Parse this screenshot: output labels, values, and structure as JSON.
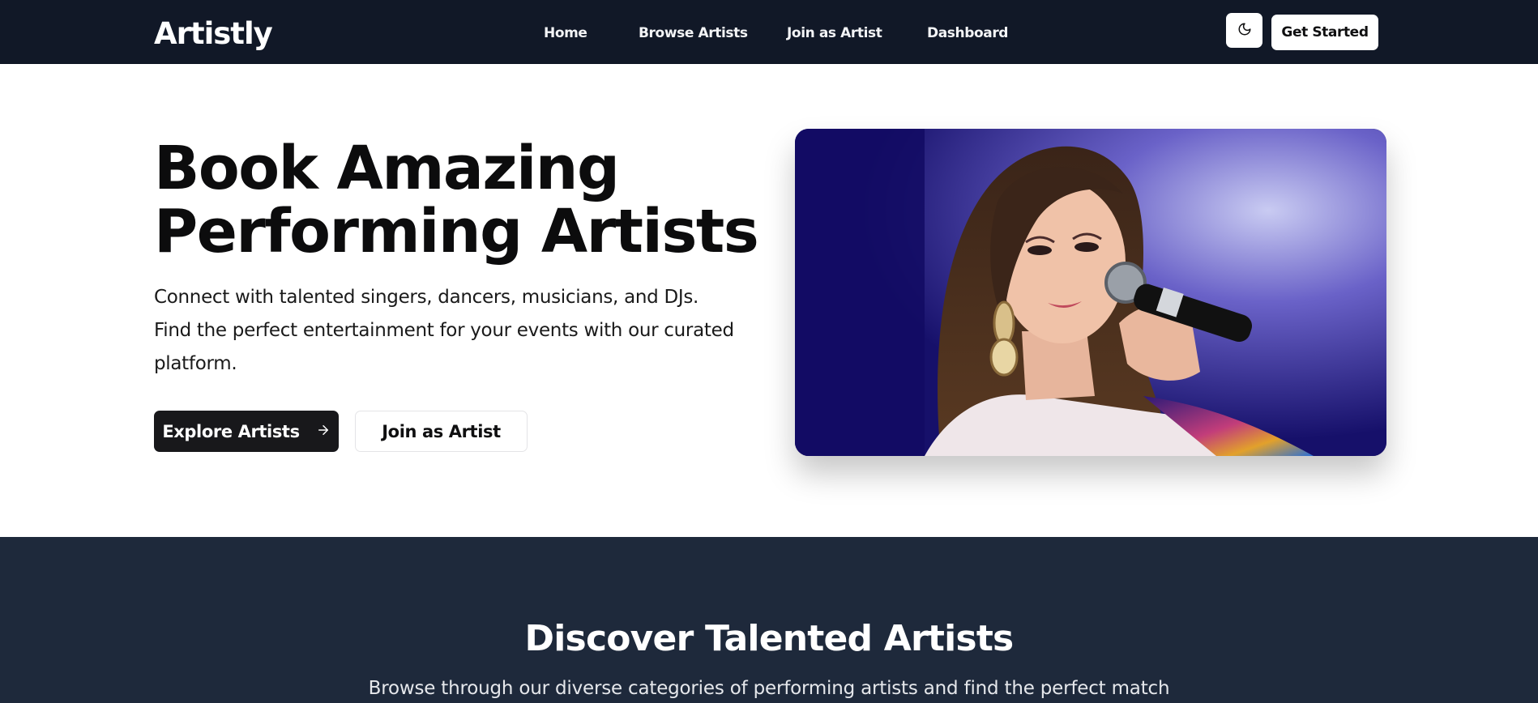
{
  "navbar": {
    "brand": "Artistly",
    "links": [
      {
        "label": "Home"
      },
      {
        "label": "Browse Artists"
      },
      {
        "label": "Join as Artist"
      },
      {
        "label": "Dashboard"
      }
    ],
    "theme_toggle_icon": "moon-icon",
    "get_started_label": "Get Started"
  },
  "hero": {
    "title_line1": "Book Amazing",
    "title_line2": "Performing Artists",
    "description": "Connect with talented singers, dancers, musicians, and DJs. Find the perfect entertainment for your events with our curated platform.",
    "primary_button_label": "Explore Artists",
    "primary_button_icon": "arrow-right-icon",
    "secondary_button_label": "Join as Artist",
    "image_subject": "performer-singing-photo"
  },
  "discover": {
    "title": "Discover Talented Artists",
    "subtitle": "Browse through our diverse categories of performing artists and find the perfect match"
  },
  "colors": {
    "navbar_bg": "#111827",
    "discover_bg": "#1e293b",
    "primary_button_bg": "#18181b",
    "text_dark": "#0c0c0d"
  }
}
